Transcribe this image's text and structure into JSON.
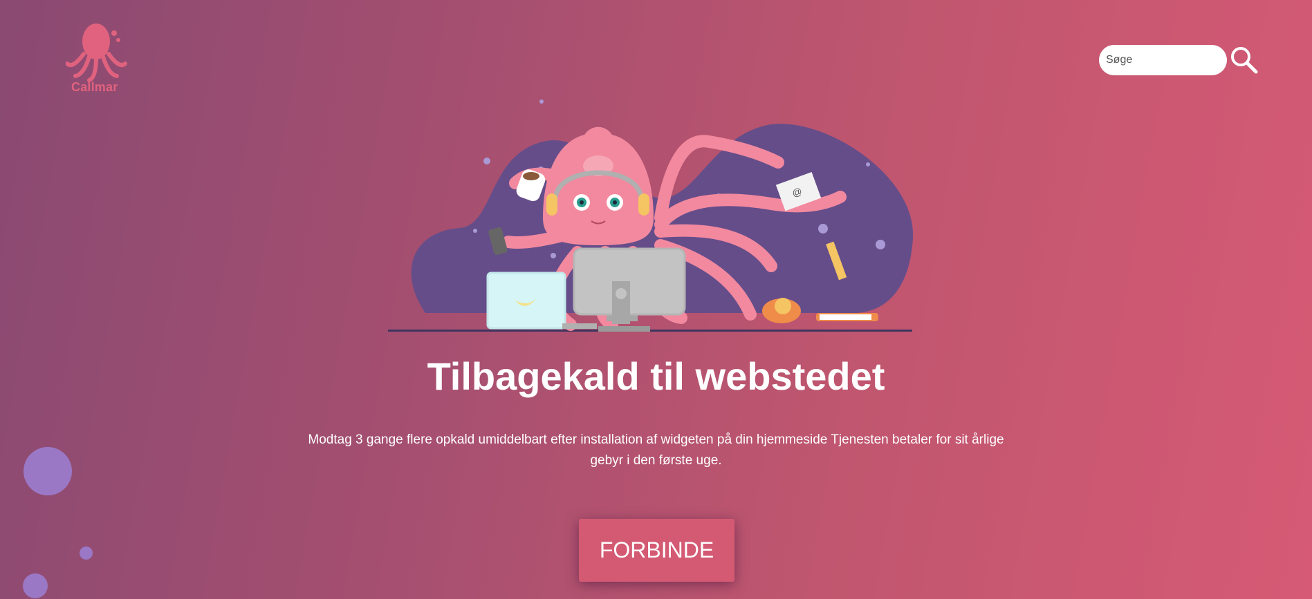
{
  "brand": {
    "name": "Callmar",
    "logo_icon": "octopus-icon",
    "color": "#e0627e"
  },
  "search": {
    "placeholder": "Søge",
    "value": "",
    "icon": "magnifier-icon"
  },
  "hero": {
    "title": "Tilbagekald til webstedet",
    "description": "Modtag 3 gange flere opkald umiddelbart efter installation af widgeten på din hjemmeside Tjenesten betaler for sit årlige gebyr i den første uge.",
    "cta_label": "FORBINDE",
    "illustration": "octopus-call-center-illustration"
  },
  "colors": {
    "background_start": "#8a4a72",
    "background_end": "#d65a75",
    "accent": "#d45a73",
    "blob": "#654d8a",
    "bubble": "#9b78c6"
  }
}
